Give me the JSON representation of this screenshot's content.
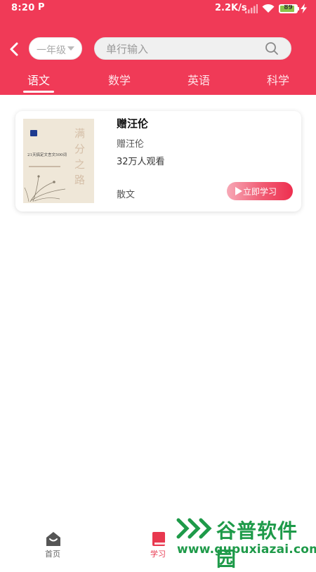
{
  "status_bar": {
    "time": "8:20",
    "app_indicator": "P",
    "network_speed": "2.2K/s",
    "battery_level": "89",
    "battery_percent": 89
  },
  "header": {
    "grade_select": {
      "value": "一年级",
      "icon": "caret-down-icon"
    },
    "search": {
      "placeholder": "单行输入",
      "value": "",
      "icon": "search-icon"
    },
    "tabs": [
      {
        "label": "语文",
        "active": true
      },
      {
        "label": "数学",
        "active": false
      },
      {
        "label": "英语",
        "active": false
      },
      {
        "label": "科学",
        "active": false
      }
    ]
  },
  "course_card": {
    "cover": {
      "big_title": "满分之路",
      "small_title": "21天搞定文言文500词"
    },
    "title": "赠汪伦",
    "author": "赠汪伦",
    "views": "32万人观看",
    "genre": "散文",
    "button_label": "立即学习"
  },
  "bottom_nav": [
    {
      "label": "首页",
      "icon": "home-icon",
      "active": false
    },
    {
      "label": "学习",
      "icon": "book-icon",
      "active": true
    }
  ],
  "watermark": {
    "name": "谷普软件园",
    "url": "www.gupuxiazai.com"
  },
  "colors": {
    "primary": "#f03a57",
    "active_nav": "#e8384f",
    "watermark": "#1e9a49"
  }
}
